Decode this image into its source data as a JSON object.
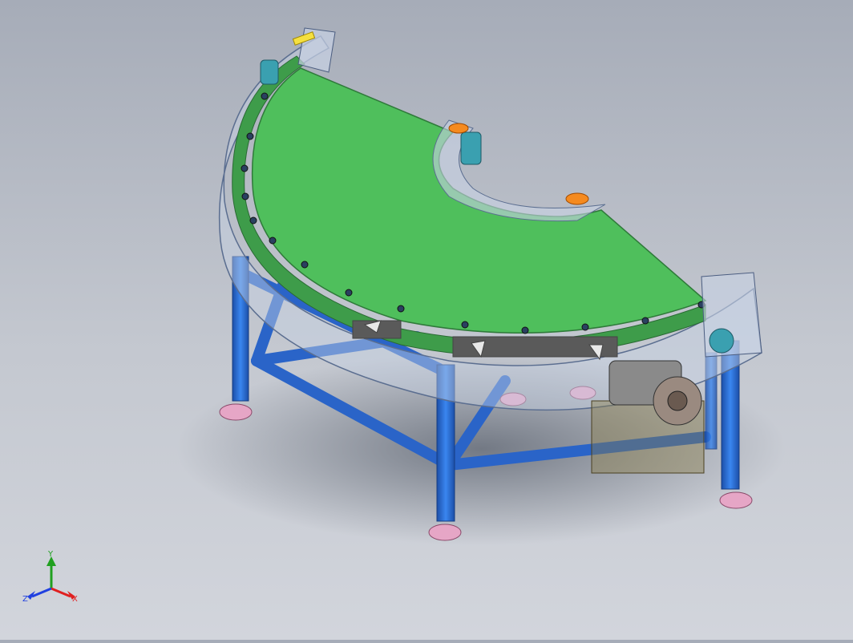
{
  "triad": {
    "x_label": "X",
    "y_label": "Y",
    "z_label": "Z",
    "x_color": "#e02020",
    "y_color": "#20a020",
    "z_color": "#2040e0"
  },
  "colors": {
    "belt": "#4fbf5c",
    "frame": "#2f6fd6",
    "feet": "#e0a0c0",
    "guard": "#c8d2e4",
    "bearing": "#3aa0b0",
    "tab": "#f58a1f"
  },
  "icons": [
    "belt-conveyor-model",
    "coordinate-triad-icon"
  ]
}
